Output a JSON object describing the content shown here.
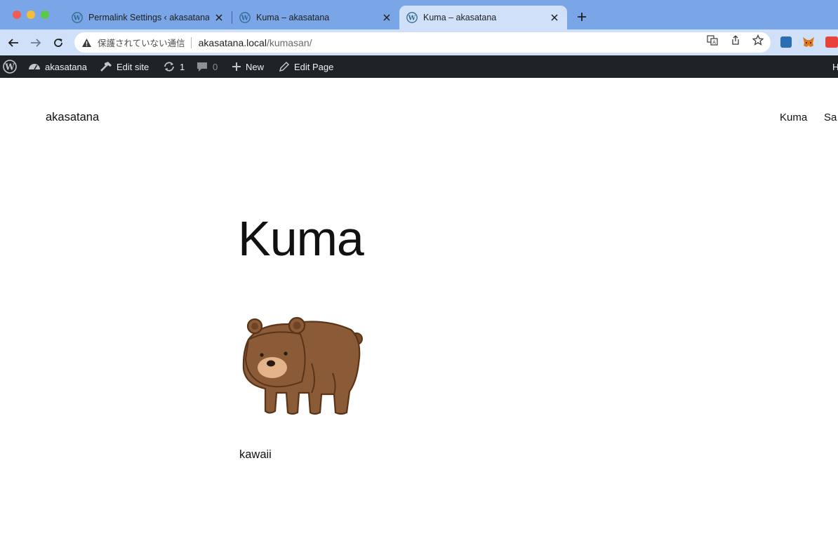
{
  "browser": {
    "tabs": [
      {
        "title": "Permalink Settings ‹ akasatana — WordPress",
        "active": false
      },
      {
        "title": "Kuma – akasatana",
        "active": false
      },
      {
        "title": "Kuma – akasatana",
        "active": true
      }
    ],
    "address_bar": {
      "security_text": "保護されていない通信",
      "url_host": "akasatana.local",
      "url_path": "/kumasan/"
    },
    "colors": {
      "tabstrip": "#7aa5e6",
      "toolbar": "#cfe0f8"
    }
  },
  "admin_bar": {
    "site_name": "akasatana",
    "edit_site": "Edit site",
    "updates_count": "1",
    "comments_count": "0",
    "new_label": "New",
    "edit_page": "Edit Page",
    "howdy_partial": "H"
  },
  "site": {
    "title": "akasatana",
    "nav": [
      "Kuma",
      "Sa"
    ]
  },
  "page": {
    "title": "Kuma",
    "image_icon": "bear-illustration",
    "paragraph": "kawaii"
  }
}
